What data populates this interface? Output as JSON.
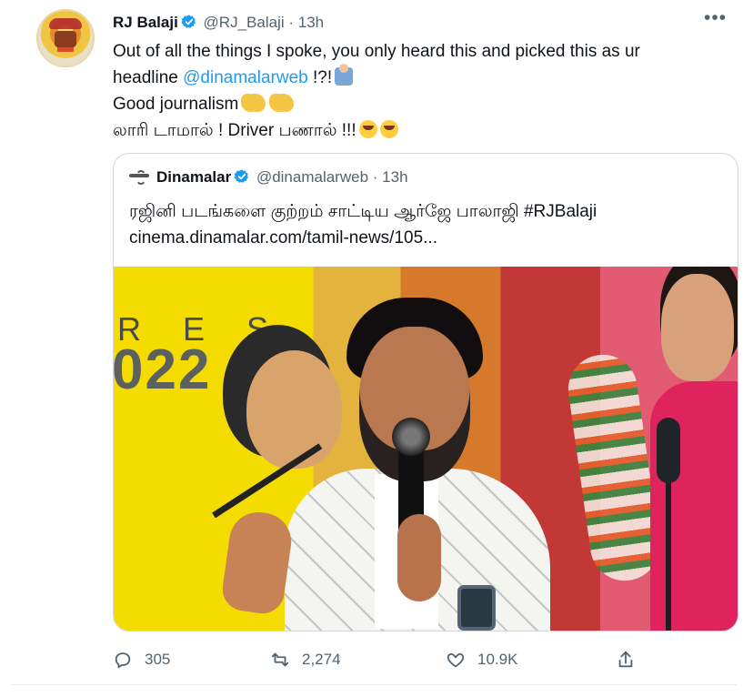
{
  "tweet": {
    "author_name": "RJ Balaji",
    "author_handle": "@RJ_Balaji",
    "separator": "·",
    "time": "13h",
    "more_icon": "more-horizontal-icon",
    "line1": "Out of all the things I spoke, you only heard this and picked this as ur",
    "line2_prefix": "headline ",
    "line2_mention": "@dinamalarweb",
    "line2_suffix": " !?!",
    "line3": "Good journalism",
    "line4": "லாரி டாமால் ! Driver பணால் !!!"
  },
  "quoted_tweet": {
    "author_name": "Dinamalar",
    "author_handle": "@dinamalarweb",
    "separator": "·",
    "time": "13h",
    "line1": "ரஜினி படங்களை குற்றம் சாட்டிய ஆர்ஜே பாலாஜி #RJBalaji",
    "line2": "cinema.dinamalar.com/tamil-news/105..."
  },
  "photo": {
    "poster_text": "R E S",
    "poster_year": "022"
  },
  "actions": {
    "reply_count": "305",
    "retweet_count": "2,274",
    "like_count": "10.9K"
  },
  "colors": {
    "link": "#1d9bf0",
    "muted": "#536471",
    "border": "#cfd9de"
  }
}
